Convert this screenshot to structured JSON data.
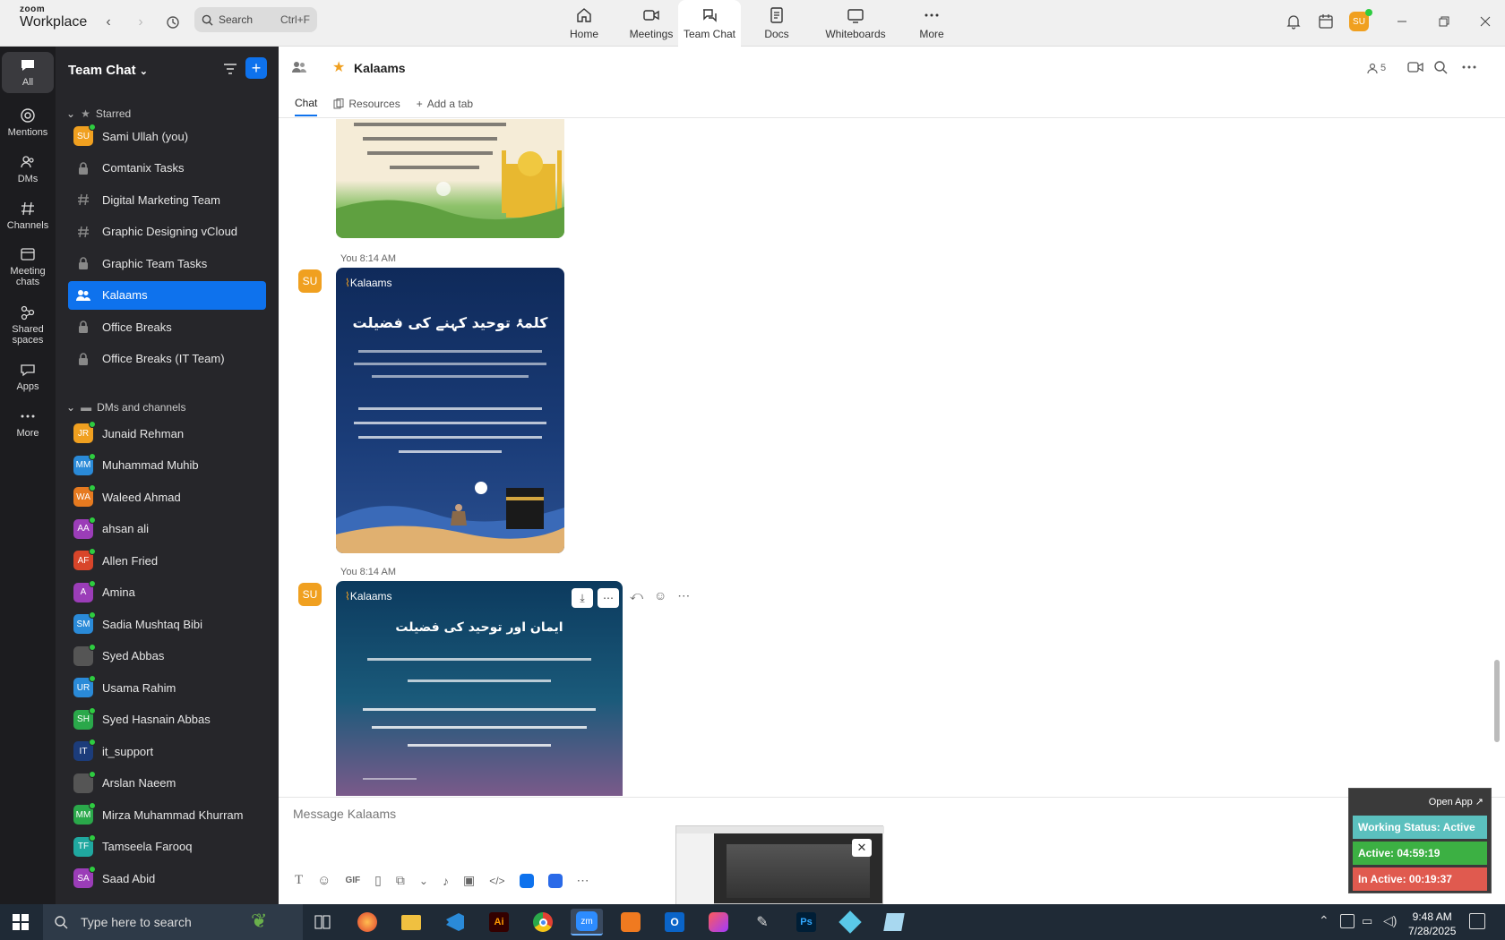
{
  "app": {
    "brand_top": "zoom",
    "brand_bottom": "Workplace"
  },
  "search": {
    "placeholder": "Search",
    "shortcut": "Ctrl+F"
  },
  "top_tabs": [
    {
      "label": "Home"
    },
    {
      "label": "Meetings"
    },
    {
      "label": "Team Chat"
    },
    {
      "label": "Docs"
    },
    {
      "label": "Whiteboards"
    },
    {
      "label": "More"
    }
  ],
  "user_avatar": "SU",
  "rail": [
    {
      "label": "All"
    },
    {
      "label": "Mentions"
    },
    {
      "label": "DMs"
    },
    {
      "label": "Channels"
    },
    {
      "label": "Meeting chats"
    },
    {
      "label": "Shared spaces"
    },
    {
      "label": "Apps"
    },
    {
      "label": "More"
    }
  ],
  "sidebar": {
    "title": "Team Chat",
    "starred_label": "Starred",
    "starred": [
      {
        "label": "Sami Ullah (you)",
        "initials": "SU",
        "color": "#f0a020",
        "kind": "avatar"
      },
      {
        "label": "Comtanix Tasks",
        "kind": "lock"
      },
      {
        "label": "Digital Marketing Team",
        "kind": "hash"
      },
      {
        "label": "Graphic Designing vCloud",
        "kind": "hash"
      },
      {
        "label": "Graphic Team Tasks",
        "kind": "lock"
      },
      {
        "label": "Kalaams",
        "kind": "group"
      },
      {
        "label": "Office Breaks",
        "kind": "lock"
      },
      {
        "label": "Office Breaks (IT Team)",
        "kind": "lock"
      }
    ],
    "dms_label": "DMs and channels",
    "dms": [
      {
        "label": "Junaid Rehman",
        "initials": "JR",
        "color": "#f0a020"
      },
      {
        "label": "Muhammad Muhib",
        "initials": "MM",
        "color": "#2a8ad8"
      },
      {
        "label": "Waleed Ahmad",
        "initials": "WA",
        "color": "#e67a20"
      },
      {
        "label": "ahsan ali",
        "initials": "AA",
        "color": "#9b3db8"
      },
      {
        "label": "Allen Fried",
        "initials": "AF",
        "color": "#d8452a"
      },
      {
        "label": "Amina",
        "initials": "A",
        "color": "#9b3db8"
      },
      {
        "label": "Sadia Mushtaq Bibi",
        "initials": "SM",
        "color": "#2a8ad8"
      },
      {
        "label": "Syed Abbas",
        "initials": "",
        "color": "#555555"
      },
      {
        "label": "Usama Rahim",
        "initials": "UR",
        "color": "#2a8ad8"
      },
      {
        "label": "Syed Hasnain Abbas",
        "initials": "SH",
        "color": "#2aa84a"
      },
      {
        "label": "it_support",
        "initials": "IT",
        "color": "#1c3c7a"
      },
      {
        "label": "Arslan Naeem",
        "initials": "",
        "color": "#555555"
      },
      {
        "label": "Mirza Muhammad Khurram",
        "initials": "MM",
        "color": "#2aa84a"
      },
      {
        "label": "Tamseela Farooq",
        "initials": "TF",
        "color": "#20a8a0"
      },
      {
        "label": "Saad Abid",
        "initials": "SA",
        "color": "#9b3db8"
      }
    ]
  },
  "chat": {
    "title": "Kalaams",
    "member_count": "5",
    "tabs": [
      {
        "label": "Chat"
      },
      {
        "label": "Resources"
      },
      {
        "label": "Add a tab"
      }
    ],
    "messages": [
      {
        "sender": "You",
        "time": "8:14 AM",
        "avatar": "SU",
        "image_brand": "Kalaams",
        "image_title": "کلمۂ توحید کہنے کی فضیلت"
      },
      {
        "sender": "You",
        "time": "8:14 AM",
        "avatar": "SU",
        "image_brand": "Kalaams",
        "image_title": "ایمان اور توحید کی فضیلت"
      }
    ],
    "composer_placeholder": "Message Kalaams"
  },
  "status_widget": {
    "open_app": "Open App ↗",
    "working_status": "Working Status: Active",
    "active": "Active: 04:59:19",
    "inactive": "In Active: 00:19:37",
    "colors": {
      "working": "#5bc0be",
      "active": "#3cb043",
      "inactive": "#e05a4f"
    }
  },
  "taskbar": {
    "search_placeholder": "Type here to search",
    "time": "9:48 AM",
    "date": "7/28/2025"
  }
}
